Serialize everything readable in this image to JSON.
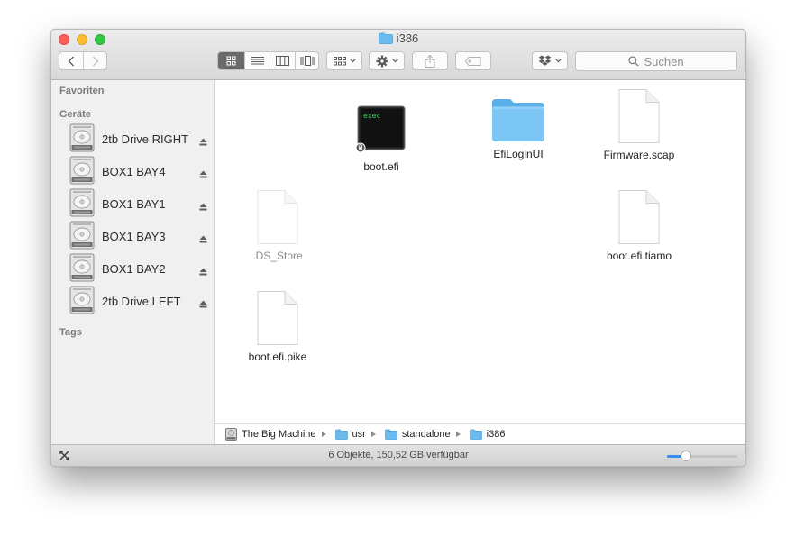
{
  "window": {
    "title": "i386"
  },
  "toolbar": {
    "search_placeholder": "Suchen"
  },
  "sidebar": {
    "favorites_header": "Favoriten",
    "devices_header": "Geräte",
    "tags_header": "Tags",
    "devices": [
      {
        "label": "2tb Drive RIGHT"
      },
      {
        "label": "BOX1 BAY4"
      },
      {
        "label": "BOX1 BAY1"
      },
      {
        "label": "BOX1 BAY3"
      },
      {
        "label": "BOX1 BAY2"
      },
      {
        "label": "2tb Drive LEFT"
      }
    ]
  },
  "files": [
    {
      "name": "boot.efi",
      "icon": "exec-icon",
      "icon_text": "exec"
    },
    {
      "name": "EfiLoginUI",
      "icon": "folder-icon"
    },
    {
      "name": "Firmware.scap",
      "icon": "document-icon"
    },
    {
      "name": ".DS_Store",
      "icon": "document-icon",
      "hidden": true
    },
    {
      "name": "boot.efi.tiamo",
      "icon": "document-icon"
    },
    {
      "name": "boot.efi.pike",
      "icon": "document-icon"
    }
  ],
  "path": [
    {
      "label": "The Big Machine",
      "icon": "hard-drive-icon"
    },
    {
      "label": "usr",
      "icon": "folder-icon"
    },
    {
      "label": "standalone",
      "icon": "folder-icon"
    },
    {
      "label": "i386",
      "icon": "folder-icon"
    }
  ],
  "status": {
    "text": "6 Objekte, 150,52 GB verfügbar"
  },
  "icon_size_slider": {
    "value": 0.27
  },
  "colors": {
    "folder": "#6cbbf0",
    "close": "#fc5f57",
    "minimize": "#fdbc2e",
    "maximize": "#33c748",
    "accent": "#3b8bf5"
  }
}
